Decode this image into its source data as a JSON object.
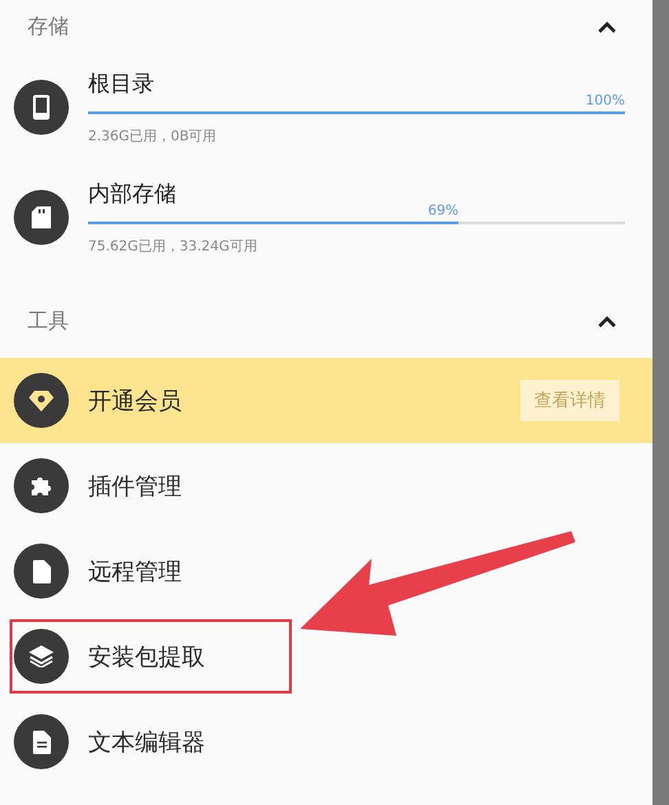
{
  "sections": [
    {
      "title": "存储",
      "expanded": true,
      "kind": "storage",
      "items": [
        {
          "name": "根目录",
          "level": 1,
          "percent": "100%",
          "usage": "2.36G已用，0B可用"
        },
        {
          "name": "内部存储",
          "level": 0.69,
          "percent": "69%",
          "usage": "75.62G已用，33.24G可用"
        }
      ]
    },
    {
      "title": "工具",
      "expanded": true,
      "kind": "tools",
      "items": [
        {
          "name": "开通会员",
          "kind": "promo",
          "button": "查看详情",
          "annotated": false
        },
        {
          "name": "插件管理",
          "kind": "plain",
          "annotated": false
        },
        {
          "name": "远程管理",
          "kind": "plain",
          "annotated": false
        },
        {
          "name": "安装包提取",
          "kind": "plain",
          "annotated": true
        },
        {
          "name": "文本编辑器",
          "kind": "plain",
          "annotated": false
        }
      ]
    }
  ]
}
